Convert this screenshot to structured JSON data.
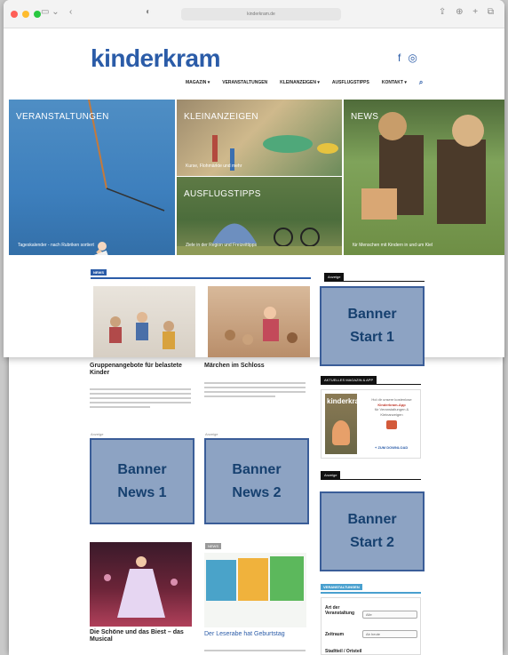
{
  "site": {
    "logo": "kinderkram",
    "nav": [
      "MAGAZIN ▾",
      "VERANSTALTUNGEN",
      "KLEINANZEIGEN ▾",
      "AUSFLUGSTIPPS",
      "KONTAKT ▾"
    ],
    "social": {
      "facebook": "f",
      "instagram": "◎"
    }
  },
  "browser": {
    "url": "kinderkram.de"
  },
  "tiles": [
    {
      "label": "VERANSTALTUNGEN",
      "caption": "Tageskalender - nach Rubriken sortiert"
    },
    {
      "label": "KLEINANZEIGEN",
      "caption": "Kurse, Flohmärkte und mehr"
    },
    {
      "label": "AUSFLUGSTIPPS",
      "caption": "Ziele in der Region und Freizeittipps"
    },
    {
      "label": "NEWS",
      "caption": "für Menschen mit Kindern in und um Kiel"
    }
  ],
  "news": {
    "tab": "NEWS",
    "cards": [
      {
        "title": "Gruppenangebote für belastete Kinder"
      },
      {
        "title": "Märchen im Schloss"
      },
      {
        "title": "Die Schöne und das Biest – das Musical"
      },
      {
        "title": "Der Leserabe hat Geburtstag"
      }
    ],
    "ad_label": "Anzeige"
  },
  "banners": {
    "start1": "Banner\nStart 1",
    "news1": "Banner\nNews 1",
    "news2": "Banner\nNews 2",
    "start2": "Banner\nStart 2"
  },
  "sidebar": {
    "ad_tab": "Anzeige",
    "magazine_tab": "AKTUELLES MAGAZIN & APP",
    "magazine_logo": "kinderkram",
    "app_text": "Hol dir unsere kostenlose",
    "app_highlight": "Kinderkram-App",
    "app_sub": "für Veranstaltungen & Kleinanzeigen",
    "download": "+ ZUM DOWNLOAD",
    "ad_tab2": "Anzeige",
    "filter_tab": "VERANSTALTUNGEN",
    "filter": [
      {
        "label": "Art der Veranstaltung",
        "value": "Alle"
      },
      {
        "label": "Zeitraum",
        "value": "Ab heute"
      },
      {
        "label": "Stadtteil / Ortsteil",
        "value": ""
      }
    ]
  },
  "colors": {
    "brand": "#2b5ca8",
    "banner_fill": "#8da3c3",
    "banner_border": "#3a5d98"
  }
}
